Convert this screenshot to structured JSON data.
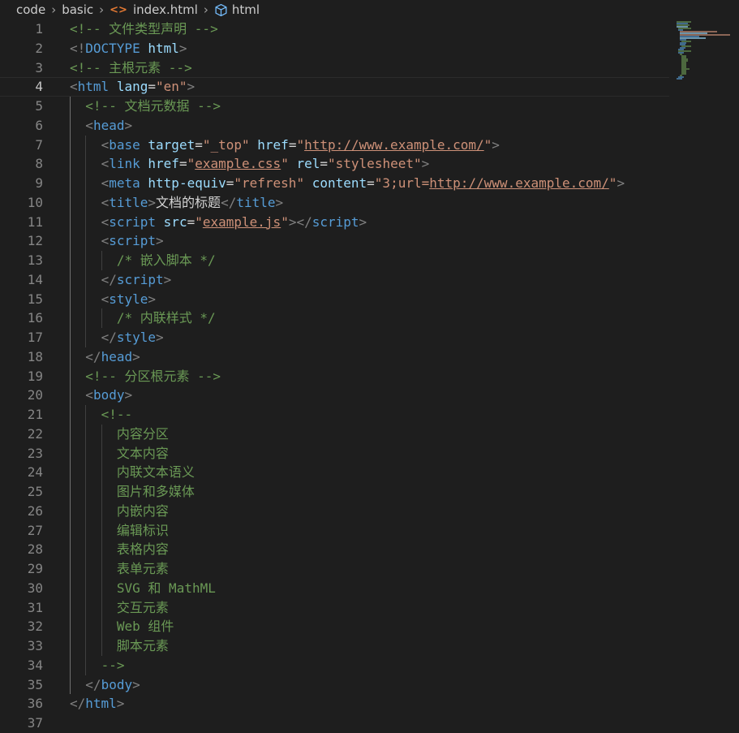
{
  "breadcrumb": {
    "folder1": "code",
    "folder2": "basic",
    "file": "index.html",
    "element": "html",
    "file_icon": "<>"
  },
  "editor": {
    "active_line": 4
  },
  "lines": [
    {
      "n": "1",
      "indent": 0,
      "tokens": [
        {
          "c": "cmt",
          "t": "<!-- 文件类型声明 -->"
        }
      ]
    },
    {
      "n": "2",
      "indent": 0,
      "tokens": [
        {
          "c": "punc",
          "t": "<!"
        },
        {
          "c": "tag",
          "t": "DOCTYPE"
        },
        {
          "c": "txt",
          "t": " "
        },
        {
          "c": "attr",
          "t": "html"
        },
        {
          "c": "punc",
          "t": ">"
        }
      ]
    },
    {
      "n": "3",
      "indent": 0,
      "tokens": [
        {
          "c": "cmt",
          "t": "<!-- 主根元素 -->"
        }
      ]
    },
    {
      "n": "4",
      "indent": 0,
      "tokens": [
        {
          "c": "punc",
          "t": "<"
        },
        {
          "c": "tag",
          "t": "html"
        },
        {
          "c": "txt",
          "t": " "
        },
        {
          "c": "attr",
          "t": "lang"
        },
        {
          "c": "eq",
          "t": "="
        },
        {
          "c": "str",
          "t": "\"en\""
        },
        {
          "c": "punc",
          "t": ">"
        }
      ]
    },
    {
      "n": "5",
      "indent": 1,
      "tokens": [
        {
          "c": "cmt",
          "t": "<!-- 文档元数据 -->"
        }
      ]
    },
    {
      "n": "6",
      "indent": 1,
      "tokens": [
        {
          "c": "punc",
          "t": "<"
        },
        {
          "c": "tag",
          "t": "head"
        },
        {
          "c": "punc",
          "t": ">"
        }
      ]
    },
    {
      "n": "7",
      "indent": 2,
      "tokens": [
        {
          "c": "punc",
          "t": "<"
        },
        {
          "c": "tag",
          "t": "base"
        },
        {
          "c": "txt",
          "t": " "
        },
        {
          "c": "attr",
          "t": "target"
        },
        {
          "c": "eq",
          "t": "="
        },
        {
          "c": "str",
          "t": "\"_top\""
        },
        {
          "c": "txt",
          "t": " "
        },
        {
          "c": "attr",
          "t": "href"
        },
        {
          "c": "eq",
          "t": "="
        },
        {
          "c": "str",
          "t": "\""
        },
        {
          "c": "link",
          "t": "http://www.example.com/"
        },
        {
          "c": "str",
          "t": "\""
        },
        {
          "c": "punc",
          "t": ">"
        }
      ]
    },
    {
      "n": "8",
      "indent": 2,
      "tokens": [
        {
          "c": "punc",
          "t": "<"
        },
        {
          "c": "tag",
          "t": "link"
        },
        {
          "c": "txt",
          "t": " "
        },
        {
          "c": "attr",
          "t": "href"
        },
        {
          "c": "eq",
          "t": "="
        },
        {
          "c": "str",
          "t": "\""
        },
        {
          "c": "link",
          "t": "example.css"
        },
        {
          "c": "str",
          "t": "\""
        },
        {
          "c": "txt",
          "t": " "
        },
        {
          "c": "attr",
          "t": "rel"
        },
        {
          "c": "eq",
          "t": "="
        },
        {
          "c": "str",
          "t": "\"stylesheet\""
        },
        {
          "c": "punc",
          "t": ">"
        }
      ]
    },
    {
      "n": "9",
      "indent": 2,
      "tokens": [
        {
          "c": "punc",
          "t": "<"
        },
        {
          "c": "tag",
          "t": "meta"
        },
        {
          "c": "txt",
          "t": " "
        },
        {
          "c": "attr",
          "t": "http-equiv"
        },
        {
          "c": "eq",
          "t": "="
        },
        {
          "c": "str",
          "t": "\"refresh\""
        },
        {
          "c": "txt",
          "t": " "
        },
        {
          "c": "attr",
          "t": "content"
        },
        {
          "c": "eq",
          "t": "="
        },
        {
          "c": "str",
          "t": "\"3;url="
        },
        {
          "c": "link",
          "t": "http://www.example.com/"
        },
        {
          "c": "str",
          "t": "\""
        },
        {
          "c": "punc",
          "t": ">"
        }
      ]
    },
    {
      "n": "10",
      "indent": 2,
      "tokens": [
        {
          "c": "punc",
          "t": "<"
        },
        {
          "c": "tag",
          "t": "title"
        },
        {
          "c": "punc",
          "t": ">"
        },
        {
          "c": "txt",
          "t": "文档的标题"
        },
        {
          "c": "punc",
          "t": "</"
        },
        {
          "c": "tag",
          "t": "title"
        },
        {
          "c": "punc",
          "t": ">"
        }
      ]
    },
    {
      "n": "11",
      "indent": 2,
      "tokens": [
        {
          "c": "punc",
          "t": "<"
        },
        {
          "c": "tag",
          "t": "script"
        },
        {
          "c": "txt",
          "t": " "
        },
        {
          "c": "attr",
          "t": "src"
        },
        {
          "c": "eq",
          "t": "="
        },
        {
          "c": "str",
          "t": "\""
        },
        {
          "c": "link",
          "t": "example.js"
        },
        {
          "c": "str",
          "t": "\""
        },
        {
          "c": "punc",
          "t": "></"
        },
        {
          "c": "tag",
          "t": "script"
        },
        {
          "c": "punc",
          "t": ">"
        }
      ]
    },
    {
      "n": "12",
      "indent": 2,
      "tokens": [
        {
          "c": "punc",
          "t": "<"
        },
        {
          "c": "tag",
          "t": "script"
        },
        {
          "c": "punc",
          "t": ">"
        }
      ]
    },
    {
      "n": "13",
      "indent": 3,
      "tokens": [
        {
          "c": "cmt",
          "t": "/* 嵌入脚本 */"
        }
      ]
    },
    {
      "n": "14",
      "indent": 2,
      "tokens": [
        {
          "c": "punc",
          "t": "</"
        },
        {
          "c": "tag",
          "t": "script"
        },
        {
          "c": "punc",
          "t": ">"
        }
      ]
    },
    {
      "n": "15",
      "indent": 2,
      "tokens": [
        {
          "c": "punc",
          "t": "<"
        },
        {
          "c": "tag",
          "t": "style"
        },
        {
          "c": "punc",
          "t": ">"
        }
      ]
    },
    {
      "n": "16",
      "indent": 3,
      "tokens": [
        {
          "c": "cmt",
          "t": "/* 内联样式 */"
        }
      ]
    },
    {
      "n": "17",
      "indent": 2,
      "tokens": [
        {
          "c": "punc",
          "t": "</"
        },
        {
          "c": "tag",
          "t": "style"
        },
        {
          "c": "punc",
          "t": ">"
        }
      ]
    },
    {
      "n": "18",
      "indent": 1,
      "tokens": [
        {
          "c": "punc",
          "t": "</"
        },
        {
          "c": "tag",
          "t": "head"
        },
        {
          "c": "punc",
          "t": ">"
        }
      ]
    },
    {
      "n": "19",
      "indent": 1,
      "tokens": [
        {
          "c": "cmt",
          "t": "<!-- 分区根元素 -->"
        }
      ]
    },
    {
      "n": "20",
      "indent": 1,
      "tokens": [
        {
          "c": "punc",
          "t": "<"
        },
        {
          "c": "tag",
          "t": "body"
        },
        {
          "c": "punc",
          "t": ">"
        }
      ]
    },
    {
      "n": "21",
      "indent": 2,
      "tokens": [
        {
          "c": "cmt",
          "t": "<!--"
        }
      ]
    },
    {
      "n": "22",
      "indent": 3,
      "tokens": [
        {
          "c": "cmt",
          "t": "内容分区"
        }
      ]
    },
    {
      "n": "23",
      "indent": 3,
      "tokens": [
        {
          "c": "cmt",
          "t": "文本内容"
        }
      ]
    },
    {
      "n": "24",
      "indent": 3,
      "tokens": [
        {
          "c": "cmt",
          "t": "内联文本语义"
        }
      ]
    },
    {
      "n": "25",
      "indent": 3,
      "tokens": [
        {
          "c": "cmt",
          "t": "图片和多媒体"
        }
      ]
    },
    {
      "n": "26",
      "indent": 3,
      "tokens": [
        {
          "c": "cmt",
          "t": "内嵌内容"
        }
      ]
    },
    {
      "n": "27",
      "indent": 3,
      "tokens": [
        {
          "c": "cmt",
          "t": "编辑标识"
        }
      ]
    },
    {
      "n": "28",
      "indent": 3,
      "tokens": [
        {
          "c": "cmt",
          "t": "表格内容"
        }
      ]
    },
    {
      "n": "29",
      "indent": 3,
      "tokens": [
        {
          "c": "cmt",
          "t": "表单元素"
        }
      ]
    },
    {
      "n": "30",
      "indent": 3,
      "tokens": [
        {
          "c": "cmt",
          "t": "SVG 和 MathML"
        }
      ]
    },
    {
      "n": "31",
      "indent": 3,
      "tokens": [
        {
          "c": "cmt",
          "t": "交互元素"
        }
      ]
    },
    {
      "n": "32",
      "indent": 3,
      "tokens": [
        {
          "c": "cmt",
          "t": "Web 组件"
        }
      ]
    },
    {
      "n": "33",
      "indent": 3,
      "tokens": [
        {
          "c": "cmt",
          "t": "脚本元素"
        }
      ]
    },
    {
      "n": "34",
      "indent": 2,
      "tokens": [
        {
          "c": "cmt",
          "t": "-->"
        }
      ]
    },
    {
      "n": "35",
      "indent": 1,
      "tokens": [
        {
          "c": "punc",
          "t": "</"
        },
        {
          "c": "tag",
          "t": "body"
        },
        {
          "c": "punc",
          "t": ">"
        }
      ]
    },
    {
      "n": "36",
      "indent": 0,
      "tokens": [
        {
          "c": "punc",
          "t": "</"
        },
        {
          "c": "tag",
          "t": "html"
        },
        {
          "c": "punc",
          "t": ">"
        }
      ]
    },
    {
      "n": "37",
      "indent": 0,
      "tokens": []
    }
  ]
}
